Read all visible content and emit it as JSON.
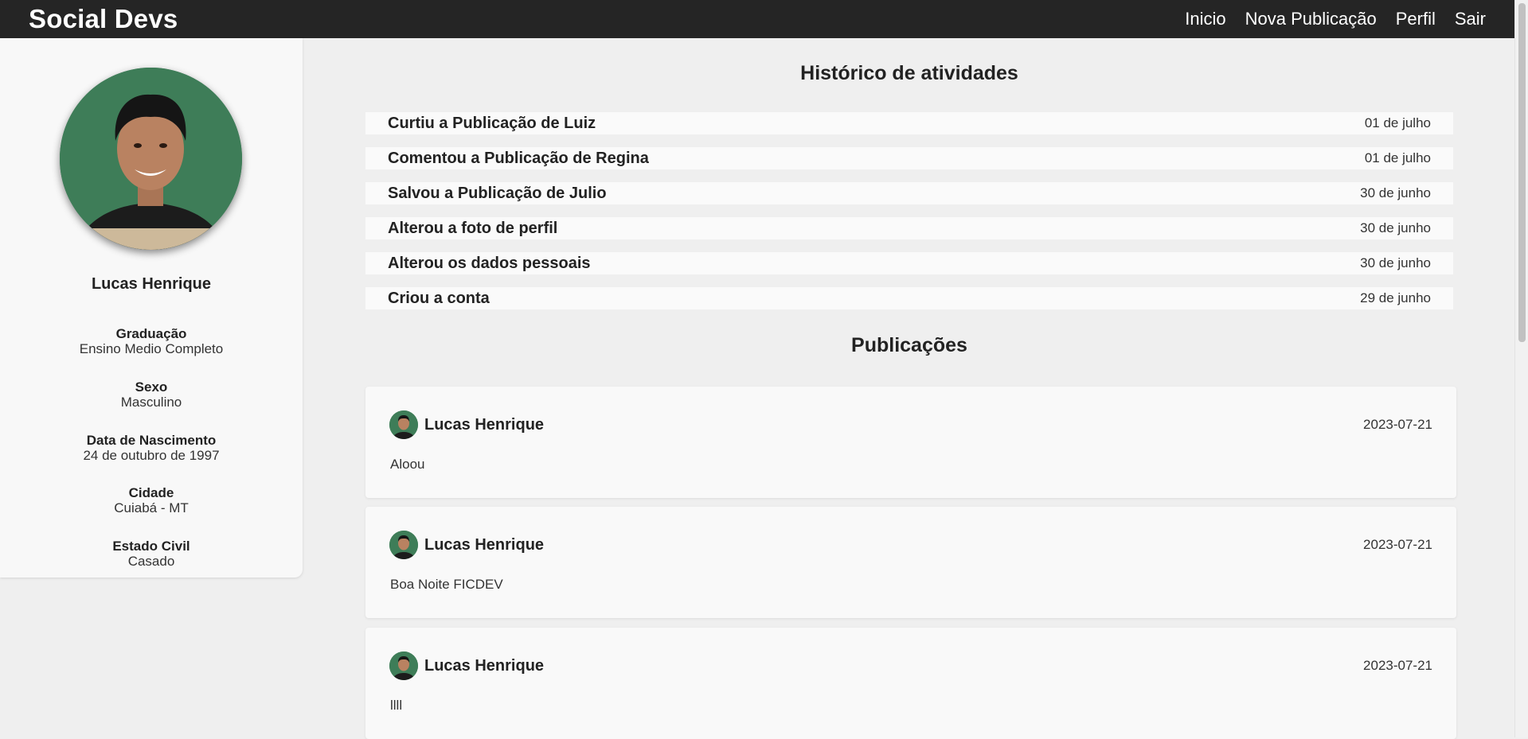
{
  "header": {
    "brand": "Social Devs",
    "nav": [
      "Inicio",
      "Nova Publicação",
      "Perfil",
      "Sair"
    ]
  },
  "profile": {
    "name": "Lucas Henrique",
    "avatar_icon": "user-photo",
    "info": [
      {
        "label": "Graduação",
        "value": "Ensino Medio Completo"
      },
      {
        "label": "Sexo",
        "value": "Masculino"
      },
      {
        "label": "Data de Nascimento",
        "value": "24 de outubro de 1997"
      },
      {
        "label": "Cidade",
        "value": "Cuiabá - MT"
      },
      {
        "label": "Estado Civil",
        "value": "Casado"
      }
    ]
  },
  "activity": {
    "title": "Histórico de atividades",
    "items": [
      {
        "text": "Curtiu a Publicação de Luiz",
        "date": "01 de julho"
      },
      {
        "text": "Comentou a Publicação de Regina",
        "date": "01 de julho"
      },
      {
        "text": "Salvou a Publicação de Julio",
        "date": "30 de junho"
      },
      {
        "text": "Alterou a foto de perfil",
        "date": "30 de junho"
      },
      {
        "text": "Alterou os dados pessoais",
        "date": "30 de junho"
      },
      {
        "text": "Criou a conta",
        "date": "29 de junho"
      }
    ]
  },
  "posts": {
    "title": "Publicações",
    "items": [
      {
        "author": "Lucas Henrique",
        "date": "2023-07-21",
        "content": "Aloou"
      },
      {
        "author": "Lucas Henrique",
        "date": "2023-07-21",
        "content": "Boa Noite FICDEV"
      },
      {
        "author": "Lucas Henrique",
        "date": "2023-07-21",
        "content": "llll"
      }
    ]
  },
  "colors": {
    "navbar": "#252525",
    "avatar_bg": "#3e7d58",
    "page_bg": "#efefef"
  }
}
